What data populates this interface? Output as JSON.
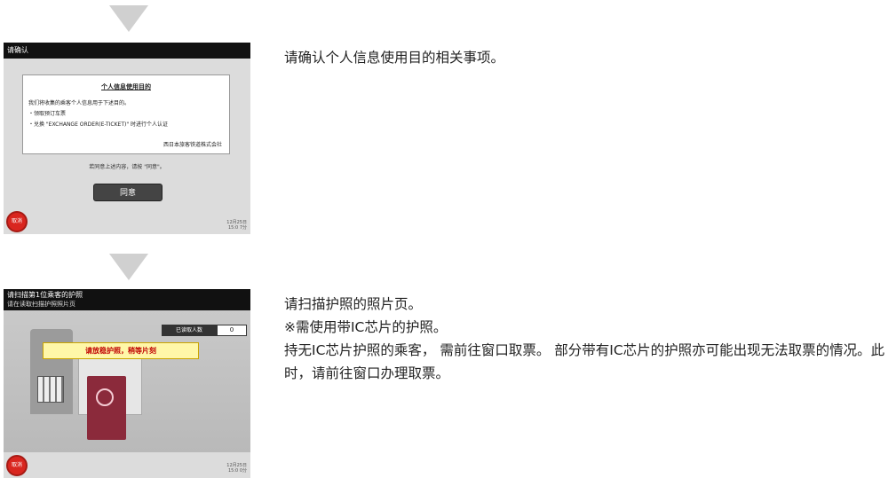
{
  "step1": {
    "screen": {
      "title": "请确认",
      "notice_heading": "个人信息使用目的",
      "notice_intro": "我们将收集的乘客个人信息用于下述目的。",
      "notice_items": [
        "・领取预订车票",
        "・兑换 \"EXCHANGE ORDER(E-TICKET)\" 时进行个人认证"
      ],
      "notice_company": "西日本旅客铁道株式会社",
      "confirm_hint": "若同意上述内容，请按 \"同意\"。",
      "agree_label": "同意",
      "cancel_label": "取消",
      "date": "12月25日",
      "time": "15:0 7分"
    },
    "description": "请确认个人信息使用目的相关事项。"
  },
  "step2": {
    "screen": {
      "title": "请扫描第1位乘客的护照",
      "subtitle": "请在读取扫描护照照片页",
      "count_label": "已读取人数",
      "count_value": "0",
      "banner": "请放稳护照，稍等片刻",
      "passport_text": "PASS PORT",
      "cancel_label": "取消",
      "date": "12月25日",
      "time": "15:0 0分"
    },
    "description_lines": [
      "请扫描护照的照片页。",
      "※需使用带IC芯片的护照。",
      "持无IC芯片护照的乘客， 需前往窗口取票。 部分带有IC芯片的护照亦可能出现无法取票的情况。此时，请前往窗口办理取票。"
    ]
  },
  "colors": {
    "arrow": "#d0d0d0",
    "titlebar": "#111111",
    "cancel": "#d9261f",
    "banner_text": "#c00000",
    "banner_bg": "#fff7a8",
    "passport": "#8b2a3b"
  }
}
